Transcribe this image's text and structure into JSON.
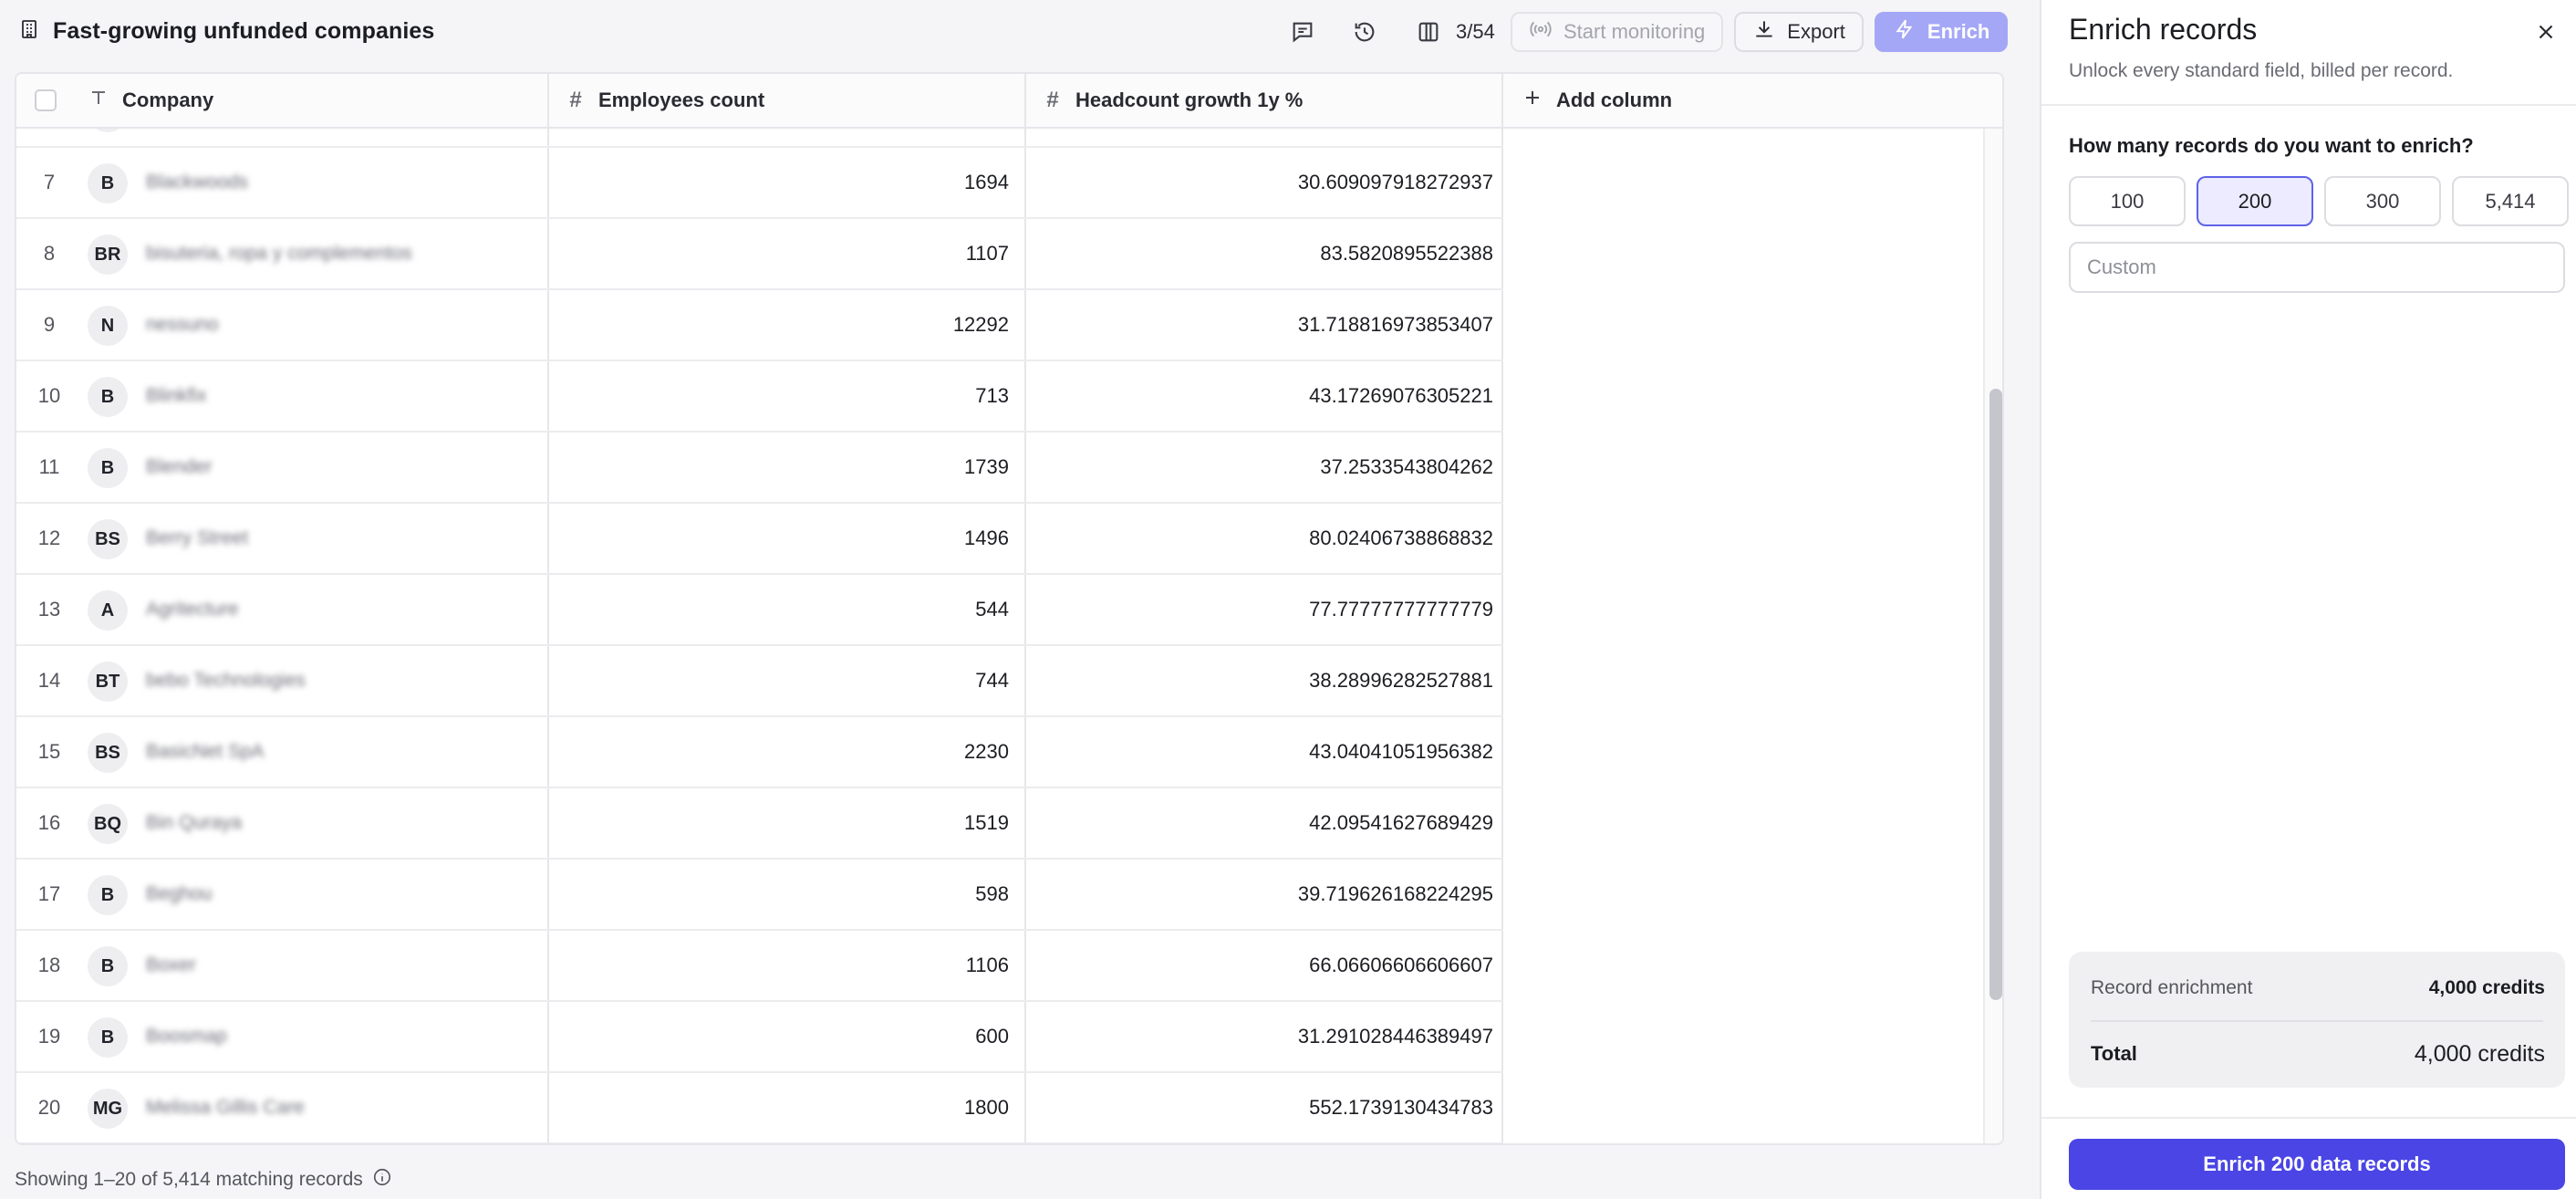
{
  "page_title": "Fast-growing unfunded companies",
  "toolbar": {
    "columns_count": "3/54",
    "start_monitoring_label": "Start monitoring",
    "export_label": "Export",
    "enrich_label": "Enrich"
  },
  "table": {
    "headers": {
      "company": "Company",
      "employees": "Employees count",
      "growth": "Headcount growth 1y %",
      "add_column": "Add column",
      "number_type_icon": "#"
    },
    "rows": [
      {
        "idx": "7",
        "initials": "B",
        "name": "Blackwoods",
        "employees": "1694",
        "growth": "30.609097918272937"
      },
      {
        "idx": "8",
        "initials": "BR",
        "name": "bisuteria, ropa y complementos",
        "employees": "1107",
        "growth": "83.5820895522388"
      },
      {
        "idx": "9",
        "initials": "N",
        "name": "nessuno",
        "employees": "12292",
        "growth": "31.718816973853407"
      },
      {
        "idx": "10",
        "initials": "B",
        "name": "Blinkfix",
        "employees": "713",
        "growth": "43.17269076305221"
      },
      {
        "idx": "11",
        "initials": "B",
        "name": "Blender",
        "employees": "1739",
        "growth": "37.2533543804262"
      },
      {
        "idx": "12",
        "initials": "BS",
        "name": "Berry Street",
        "employees": "1496",
        "growth": "80.02406738868832"
      },
      {
        "idx": "13",
        "initials": "A",
        "name": "Agritecture",
        "employees": "544",
        "growth": "77.77777777777779"
      },
      {
        "idx": "14",
        "initials": "BT",
        "name": "bebo Technologies",
        "employees": "744",
        "growth": "38.28996282527881"
      },
      {
        "idx": "15",
        "initials": "BS",
        "name": "BasicNet SpA",
        "employees": "2230",
        "growth": "43.04041051956382"
      },
      {
        "idx": "16",
        "initials": "BQ",
        "name": "Bin Quraya",
        "employees": "1519",
        "growth": "42.09541627689429"
      },
      {
        "idx": "17",
        "initials": "B",
        "name": "Beghou",
        "employees": "598",
        "growth": "39.719626168224295"
      },
      {
        "idx": "18",
        "initials": "B",
        "name": "Boxer",
        "employees": "1106",
        "growth": "66.06606606606607"
      },
      {
        "idx": "19",
        "initials": "B",
        "name": "Boosmap",
        "employees": "600",
        "growth": "31.291028446389497"
      },
      {
        "idx": "20",
        "initials": "MG",
        "name": "Melissa Gillis Care",
        "employees": "1800",
        "growth": "552.1739130434783"
      }
    ]
  },
  "footer": {
    "status": "Showing 1–20 of 5,414 matching records"
  },
  "panel": {
    "title": "Enrich records",
    "subtitle": "Unlock every standard field, billed per record.",
    "question": "How many records do you want to enrich?",
    "options": [
      "100",
      "200",
      "300",
      "5,414"
    ],
    "selected_option": "200",
    "custom_placeholder": "Custom",
    "summary": {
      "record_enrichment_label": "Record enrichment",
      "record_enrichment_value": "4,000 credits",
      "total_label": "Total",
      "total_value": "4,000 credits"
    },
    "cta_label": "Enrich 200 data records"
  },
  "colors": {
    "accent": "#4a45e4",
    "accent_light": "#a4a7f6",
    "selected_option_bg": "#ecebff"
  }
}
